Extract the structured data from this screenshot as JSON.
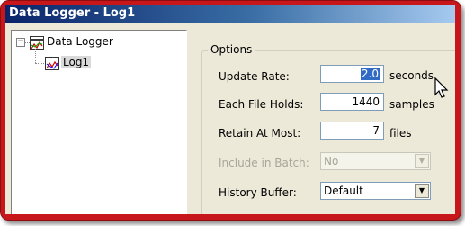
{
  "window": {
    "title": "Data Logger - Log1"
  },
  "tree": {
    "root": {
      "label": "Data Logger",
      "expander": "−"
    },
    "child": {
      "label": "Log1"
    }
  },
  "options": {
    "group_title": "Options",
    "update_rate": {
      "label": "Update Rate:",
      "value": "2.0",
      "unit": "seconds"
    },
    "file_holds": {
      "label": "Each File Holds:",
      "value": "1440",
      "unit": "samples"
    },
    "retain": {
      "label": "Retain At Most:",
      "value": "7",
      "unit": "files"
    },
    "include_batch": {
      "label": "Include in Batch:",
      "value": "No",
      "enabled": false
    },
    "history_buffer": {
      "label": "History Buffer:",
      "value": "Default"
    }
  },
  "icons": {
    "dropdown_arrow": "▼",
    "tree_root_icon": "data-logger-icon",
    "tree_child_icon": "log-icon",
    "cursor": "mouse-pointer-icon"
  },
  "colors": {
    "frame": "#c8171b",
    "selection": "#316ac5"
  }
}
